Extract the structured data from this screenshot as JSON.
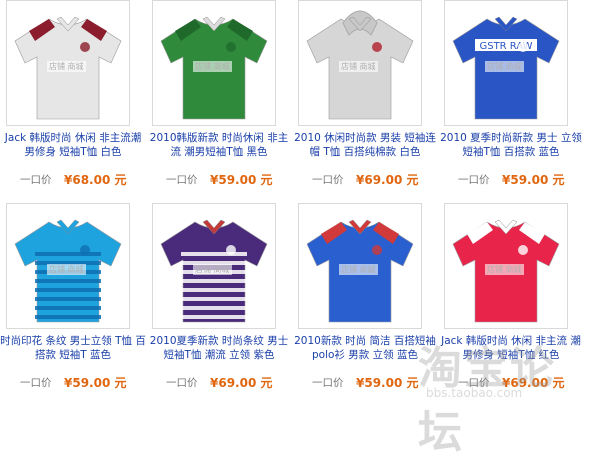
{
  "products": [
    {
      "title": "Jack 韩版时尚 休闲 非主流潮男修身 短袖T恤 白色",
      "price_label": "一口价",
      "price": "¥68.00 元",
      "shirt": {
        "body": "#e6e6e6",
        "accent": "#8b1d2c",
        "collar": "#e6e6e6",
        "stripe": null,
        "style": "plain"
      }
    },
    {
      "title": "2010韩版新款 时尚休闲 非主流 潮男短袖T恤 黑色",
      "price_label": "一口价",
      "price": "¥59.00 元",
      "shirt": {
        "body": "#2f8a3c",
        "accent": "#1f6a2a",
        "collar": "#dcdcdc",
        "stripe": null,
        "style": "plain"
      }
    },
    {
      "title": "2010 休闲时尚款 男装 短袖连帽 T恤 百搭纯棉款 白色",
      "price_label": "一口价",
      "price": "¥69.00 元",
      "shirt": {
        "body": "#d6d6d6",
        "accent": "#b01e2a",
        "collar": "#c8c8c8",
        "stripe": null,
        "style": "hood"
      }
    },
    {
      "title": "2010 夏季时尚新款 男士 立领 短袖T恤 百搭款 蓝色",
      "price_label": "一口价",
      "price": "¥59.00 元",
      "shirt": {
        "body": "#2a55c4",
        "accent": "#ffffff",
        "collar": "#2a55c4",
        "stripe": null,
        "style": "gstr"
      }
    },
    {
      "title": "时尚印花 条纹 男士立领 T恤 百搭款 短袖T 蓝色",
      "price_label": "一口价",
      "price": "¥59.00 元",
      "shirt": {
        "body": "#1fa3df",
        "accent": "#0f6fb0",
        "collar": "#1fa3df",
        "stripe": "#0f6fb0",
        "style": "stripes"
      }
    },
    {
      "title": "2010夏季新款 时尚条纹 男士 短袖T恤 潮流 立领 紫色",
      "price_label": "一口价",
      "price": "¥69.00 元",
      "shirt": {
        "body": "#4a2a7a",
        "accent": "#ffffff",
        "collar": "#c23a3a",
        "stripe": "#ffffff",
        "style": "stripes"
      }
    },
    {
      "title": "2010新款 时尚 简洁 百搭短袖 polo衫 男款 立领 蓝色",
      "price_label": "一口价",
      "price": "¥59.00 元",
      "shirt": {
        "body": "#2a5fd0",
        "accent": "#d03a3a",
        "collar": "#d03a3a",
        "stripe": null,
        "style": "plain"
      }
    },
    {
      "title": "Jack 韩版时尚 休闲 非主流 潮男修身 短袖T恤 红色",
      "price_label": "一口价",
      "price": "¥69.00 元",
      "shirt": {
        "body": "#e8244a",
        "accent": "#ffffff",
        "collar": "#ffffff",
        "stripe": null,
        "style": "plain"
      }
    }
  ],
  "watermark": {
    "logo_text": "淘宝论坛",
    "sub_text": "bbs.taobao.com",
    "thumb_text": "店铺 商城"
  }
}
